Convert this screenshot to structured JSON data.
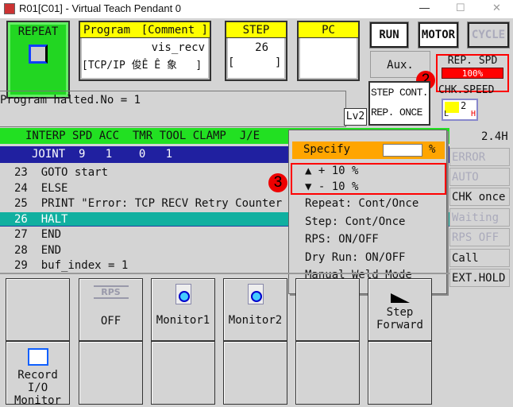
{
  "window": {
    "title": "R01[C01] - Virtual Teach Pendant 0",
    "min": "—",
    "max": "☐",
    "close": "✕"
  },
  "mode": {
    "label": "REPEAT"
  },
  "program": {
    "header_left": "Program",
    "header_right": "[Comment ]",
    "name": "vis_recv",
    "comment": "[TCP/IP 俊Ê Ê 象   ]"
  },
  "step": {
    "header": "STEP",
    "value": "26",
    "bracket": "[      ]"
  },
  "pc": {
    "header": "PC"
  },
  "top_buttons": {
    "run": "RUN",
    "motor": "MOTOR",
    "cycle": "CYCLE",
    "aux": "Aux."
  },
  "rep_spd": {
    "label": "REP. SPD",
    "value": "100%",
    "percent": 100
  },
  "chk_speed": {
    "label": "CHK.SPEED",
    "value": "2",
    "low": "L",
    "high": "H"
  },
  "step_cont": {
    "line1": "STEP CONT.",
    "line2": "REP. ONCE"
  },
  "message": "Program halted.No = 1",
  "level": "Lv2",
  "status_header": "INTERP SPD ACC  TMR TOOL CLAMP  J/E     OU",
  "status_row": "JOINT  9   1    0   1                  [",
  "cycle_time": "2.4H",
  "code_lines": [
    {
      "n": "23",
      "text": "GOTO start"
    },
    {
      "n": "24",
      "text": "ELSE"
    },
    {
      "n": "25",
      "text": "PRINT \"Error: TCP RECV Retry Counter Ex"
    },
    {
      "n": "26",
      "text": "HALT"
    },
    {
      "n": "27",
      "text": "END"
    },
    {
      "n": "28",
      "text": "END"
    },
    {
      "n": "29",
      "text": "buf_index = 1"
    }
  ],
  "popup": {
    "specify": "Specify",
    "specify_value": "",
    "unit": "%",
    "plus": "▲ + 10 %",
    "minus": "▼ - 10 %",
    "items": [
      "Repeat: Cont/Once",
      "Step: Cont/Once",
      "RPS: ON/OFF",
      "Dry Run: ON/OFF",
      "Manual Weld Mode"
    ]
  },
  "annotations": {
    "a2": "2",
    "a3": "3"
  },
  "status_buttons": [
    "ERROR",
    "AUTO",
    "CHK once",
    "Waiting",
    "RPS OFF",
    "Call mm_c",
    "EXT.HOLD"
  ],
  "function_keys": {
    "rps_icon": "RPS",
    "rps": "OFF",
    "monitor1": "Monitor1",
    "monitor2": "Monitor2",
    "step_fwd1": "Step",
    "step_fwd2": "Forward",
    "record1": "Record I/O",
    "record2": "Monitor"
  },
  "colors": {
    "green": "#22d622",
    "yellow": "#ffff00",
    "blue": "#2020a0",
    "teal": "#10b0a0",
    "orange": "#ffa500",
    "red": "#ff0000"
  }
}
